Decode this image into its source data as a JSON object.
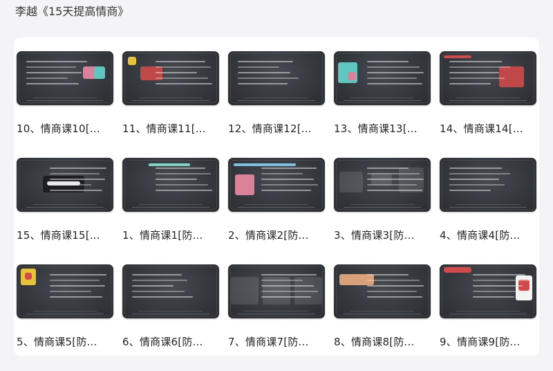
{
  "header": {
    "title": "李越《15天提高情商》"
  },
  "lessons": [
    {
      "label": "10、情商课10[...",
      "icon": "chalkboard-slide-thumbnail"
    },
    {
      "label": "11、情商课11[...",
      "icon": "chalkboard-slide-thumbnail"
    },
    {
      "label": "12、情商课12[...",
      "icon": "chalkboard-slide-thumbnail"
    },
    {
      "label": "13、情商课13[...",
      "icon": "chalkboard-slide-thumbnail"
    },
    {
      "label": "14、情商课14[...",
      "icon": "chalkboard-slide-thumbnail"
    },
    {
      "label": "15、情商课15[...",
      "icon": "chalkboard-slide-thumbnail"
    },
    {
      "label": "1、情商课1[防...",
      "icon": "chalkboard-slide-thumbnail"
    },
    {
      "label": "2、情商课2[防...",
      "icon": "chalkboard-slide-thumbnail"
    },
    {
      "label": "3、情商课3[防...",
      "icon": "chalkboard-slide-thumbnail"
    },
    {
      "label": "4、情商课4[防...",
      "icon": "chalkboard-slide-thumbnail"
    },
    {
      "label": "5、情商课5[防...",
      "icon": "chalkboard-slide-thumbnail"
    },
    {
      "label": "6、情商课6[防...",
      "icon": "chalkboard-slide-thumbnail"
    },
    {
      "label": "7、情商课7[防...",
      "icon": "chalkboard-slide-thumbnail"
    },
    {
      "label": "8、情商课8[防...",
      "icon": "chalkboard-slide-thumbnail"
    },
    {
      "label": "9、情商课9[防...",
      "icon": "chalkboard-slide-thumbnail"
    }
  ],
  "colors": {
    "chalkboard": "#34373c",
    "accent_red": "#d24a4a",
    "accent_teal": "#5fc7c0",
    "accent_yellow": "#e8c33a",
    "accent_pink": "#d9829a"
  }
}
